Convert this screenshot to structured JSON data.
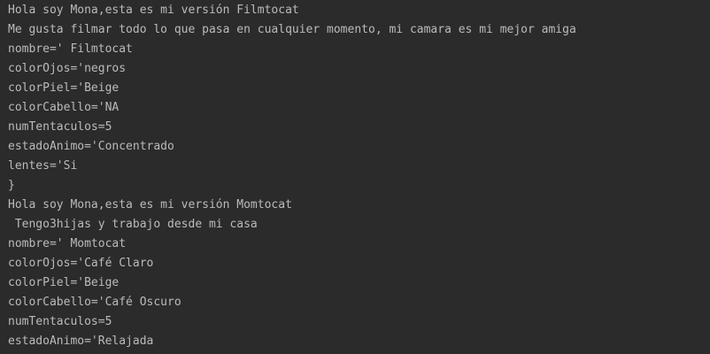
{
  "console": {
    "lines": [
      "Hola soy Mona,esta es mi versión Filmtocat",
      "Me gusta filmar todo lo que pasa en cualquier momento, mi camara es mi mejor amiga",
      "nombre=' Filmtocat",
      "colorOjos='negros",
      "colorPiel='Beige",
      "colorCabello='NA",
      "numTentaculos=5",
      "estadoAnimo='Concentrado",
      "lentes='Si",
      "}",
      "Hola soy Mona,esta es mi versión Momtocat",
      " Tengo3hijas y trabajo desde mi casa",
      "nombre=' Momtocat",
      "colorOjos='Café Claro",
      "colorPiel='Beige",
      "colorCabello='Café Oscuro",
      "numTentaculos=5",
      "estadoAnimo='Relajada"
    ]
  },
  "colors": {
    "background": "#2b2b2b",
    "text": "#bbbbbb"
  }
}
